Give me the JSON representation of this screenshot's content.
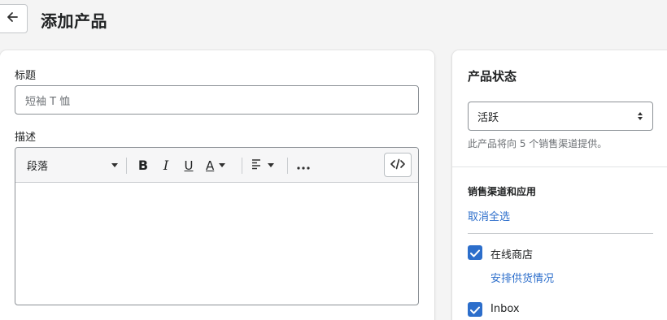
{
  "header": {
    "back_icon": "arrow-left-icon",
    "title": "添加产品"
  },
  "product": {
    "title_label": "标题",
    "title_placeholder": "短袖 T 恤",
    "description_label": "描述",
    "toolbar": {
      "format_select": "段落",
      "bold": "B",
      "italic": "I",
      "underline": "U",
      "text_color": "A",
      "align_icon": "align-left-icon",
      "more_icon": "more-horizontal-icon",
      "code_icon": "code-icon"
    }
  },
  "status": {
    "title": "产品状态",
    "selected": "活跃",
    "help": "此产品将向 5 个销售渠道提供。"
  },
  "channels": {
    "title": "销售渠道和应用",
    "deselect_all": "取消全选",
    "items": [
      {
        "label": "在线商店",
        "checked": true,
        "link": "安排供货情况"
      },
      {
        "label": "Inbox",
        "checked": true
      }
    ]
  },
  "colors": {
    "accent": "#2c6ecb",
    "background": "#f4f4f4"
  }
}
